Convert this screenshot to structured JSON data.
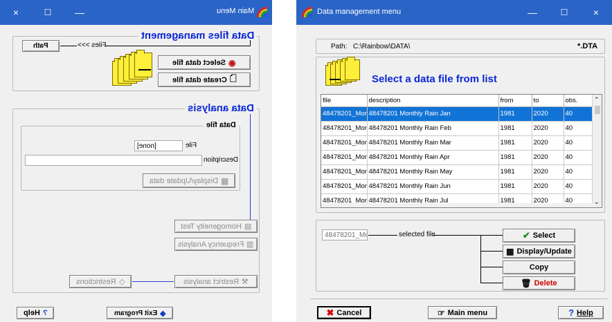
{
  "left_window": {
    "title": "Main Menu",
    "controls": [
      "×",
      "☐",
      "—"
    ],
    "data_files": {
      "title": "Data files management",
      "path_button": "Path",
      "files_label": "Files >>>",
      "select_button": "Select data file",
      "create_button": "Create data file"
    },
    "analysis": {
      "title": "Data analysis",
      "data_file_title": "Data file",
      "file_label": "File",
      "file_value": "[none]",
      "description_label": "Description",
      "description_value": "",
      "display_button": "Display/Update data",
      "homogeneity_button": "Homogeneity Test",
      "frequency_button": "Frequency Analysis",
      "restrict_button": "Restrict analysis",
      "restrictions_button": "Restrictions"
    },
    "footer": {
      "help_button": "Help",
      "exit_button": "Exit Program"
    }
  },
  "right_window": {
    "title": "Data management menu",
    "controls": [
      "—",
      "☐",
      "×"
    ],
    "path_label": "Path:",
    "path_value": "C:\\Rainbow\\DATA\\",
    "extension": "*.DTA",
    "heading": "Select a data file from list",
    "table": {
      "columns": [
        "file",
        "description",
        "from",
        "to",
        "obs."
      ],
      "rows": [
        [
          "48478201_Mon",
          "48478201 Monthly Rain Jan",
          "1981",
          "2020",
          "40"
        ],
        [
          "48478201_Mon",
          "48478201 Monthly Rain Feb",
          "1981",
          "2020",
          "40"
        ],
        [
          "48478201_Mon",
          "48478201 Monthly Rain Mar",
          "1981",
          "2020",
          "40"
        ],
        [
          "48478201_Mon",
          "48478201 Monthly Rain Apr",
          "1981",
          "2020",
          "40"
        ],
        [
          "48478201_Mon",
          "48478201 Monthly Rain May",
          "1981",
          "2020",
          "40"
        ],
        [
          "48478201_Mon",
          "48478201 Monthly Rain Jun",
          "1981",
          "2020",
          "40"
        ],
        [
          "48478201_Mon",
          "48478201 Monthly Rain Jul",
          "1981",
          "2020",
          "40"
        ]
      ],
      "selected_row": 0
    },
    "selected_field": "48478201_Mon",
    "selected_label": "selected file",
    "actions": {
      "select": "Select",
      "display": "Display/Update",
      "copy": "Copy",
      "delete": "Delete"
    },
    "footer": {
      "cancel": "Cancel",
      "main_menu": "Main menu",
      "help": "Help"
    },
    "colors": {
      "heading": "#0a27d6",
      "delete": "#d00000",
      "select_check": "#1a8f1a",
      "selection": "#1273d6"
    }
  }
}
